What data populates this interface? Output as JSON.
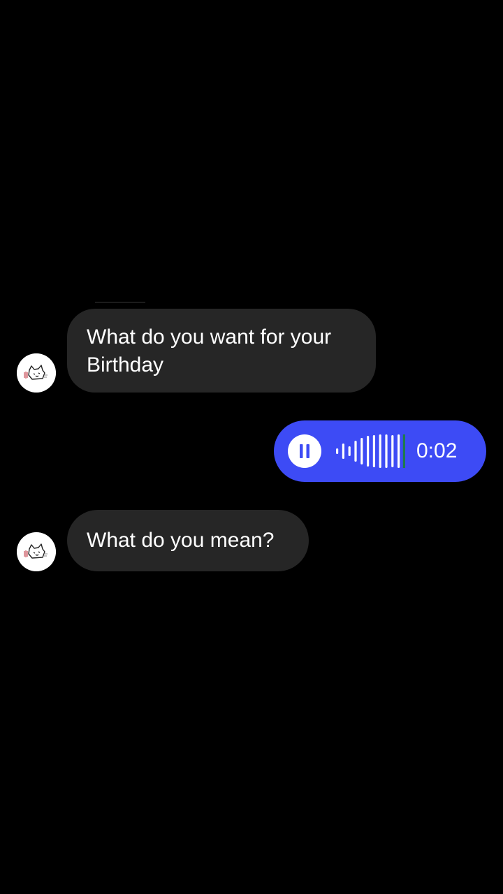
{
  "conversation": {
    "messages": [
      {
        "direction": "incoming",
        "type": "text",
        "text": "What do you want for your Birthday",
        "avatar_icon": "cat-sticker-avatar-icon"
      },
      {
        "direction": "outgoing",
        "type": "voice",
        "duration": "0:02",
        "control_icon": "pause-icon",
        "playback_progress": 1.0
      },
      {
        "direction": "incoming",
        "type": "text",
        "text": "What do you mean?",
        "avatar_icon": "cat-sticker-avatar-icon"
      }
    ]
  },
  "colors": {
    "background": "#000000",
    "incoming_bubble": "#262626",
    "outgoing_bubble": "#3d4bf5",
    "text": "#ffffff",
    "waveform_playhead": "#1f7a4d"
  }
}
